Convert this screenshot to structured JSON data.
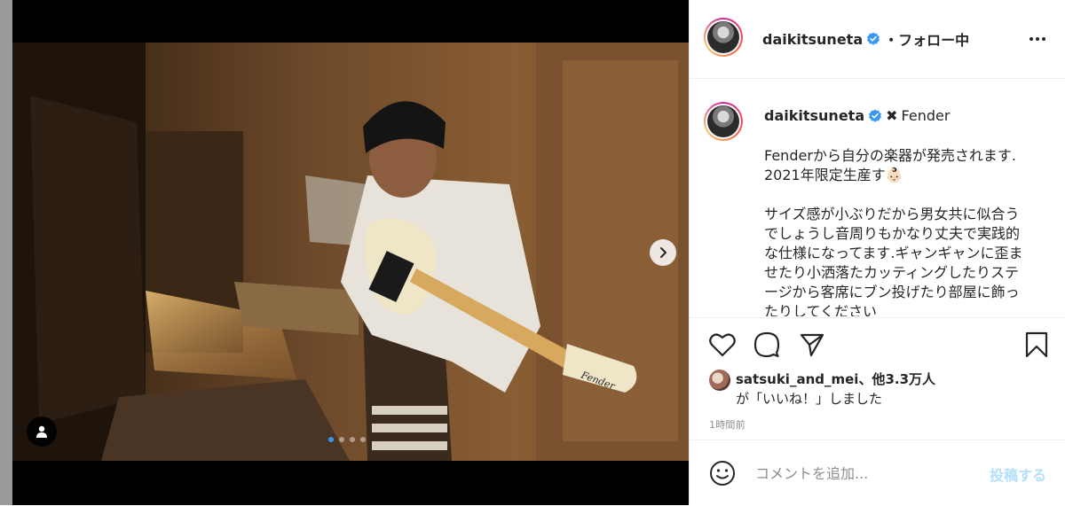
{
  "post": {
    "username": "daikitsuneta",
    "follow_state": "・フォロー中",
    "collab_mark": "✖",
    "collab_brand": "Fender",
    "caption": "Fenderから自分の楽器が発売されます.\n2021年限定生産す👶🏻\n\nサイズ感が小ぶりだから男女共に似合う\nでしょうし音周りもかなり丈夫で実践的\nな仕様になってます.ギャンギャンに歪ま\nせたり小洒落たカッティングしたりステ\nージから客席にブン投げたり部屋に飾っ\nたりしてください",
    "guitar_logo": "Fender"
  },
  "carousel": {
    "slide_count": 4,
    "active_index": 0
  },
  "likes": {
    "user": "satsuki_and_mei",
    "others": "、他3.3万人",
    "suffix": "が「いいね！」しました"
  },
  "timestamp": "1時間前",
  "comment": {
    "placeholder": "コメントを追加...",
    "post_label": "投稿する"
  },
  "colors": {
    "verified": "#3897f0",
    "post_button_disabled": "#b2dffc",
    "dot_active": "#3897f0"
  },
  "icons": {
    "more": "more-horizontal-icon",
    "like": "heart-icon",
    "comment": "comment-bubble-icon",
    "share": "paper-plane-icon",
    "save": "bookmark-icon",
    "emoji": "smiley-icon",
    "next": "chevron-right-icon",
    "user_tag": "user-tag-icon"
  }
}
